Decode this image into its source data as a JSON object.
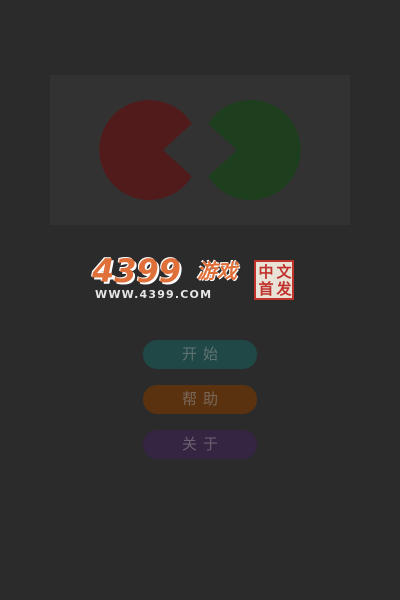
{
  "logo": {
    "number": "4399",
    "word": "游戏",
    "url": "WWW.4399.COM",
    "seal_chars": [
      "中",
      "文",
      "首",
      "发"
    ]
  },
  "menu": {
    "start_label": "开始",
    "help_label": "帮助",
    "about_label": "关于"
  },
  "colors": {
    "background": "#2b2b2b",
    "left_shape": "#521b1b",
    "right_shape": "#1d3f1d",
    "start_button": "#1f4846",
    "help_button": "#5a3210",
    "about_button": "#352442"
  }
}
